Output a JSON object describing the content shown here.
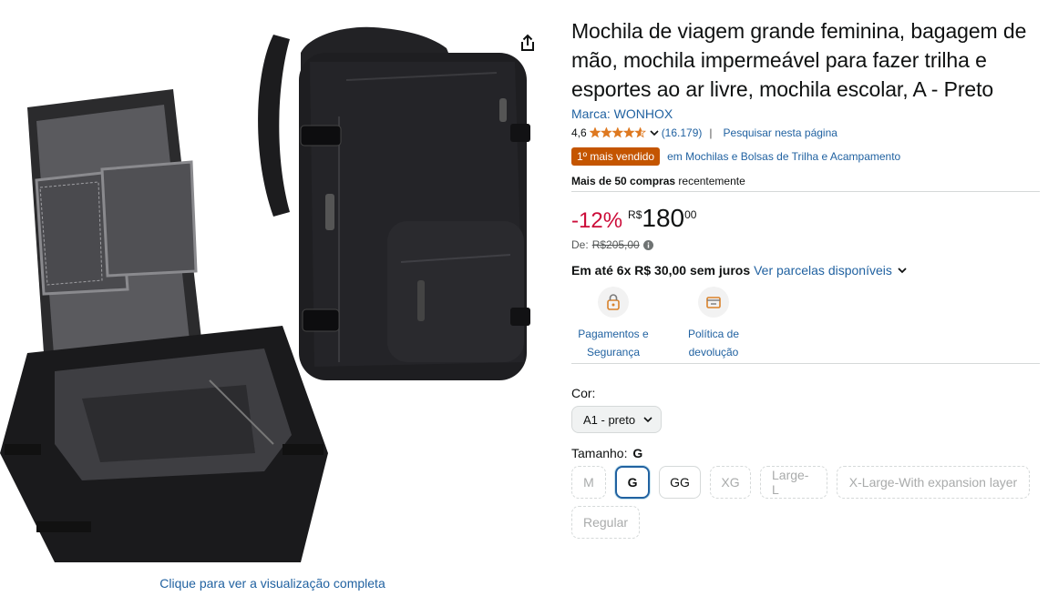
{
  "image": {
    "view_full_label": "Clique para ver a visualização completa",
    "share_icon": "share-icon"
  },
  "product": {
    "title": "Mochila de viagem grande feminina, bagagem de mão, mochila impermeável para fazer trilha e esportes ao ar livre, mochila escolar, A - Preto",
    "brand": "Marca: WONHOX",
    "rating": {
      "value": "4,6",
      "stars_fraction": 0.92,
      "count": "(16.179)",
      "separator": "|",
      "search_link": "Pesquisar nesta página"
    },
    "bestseller": {
      "badge": "1º mais vendido",
      "category": "em Mochilas e Bolsas de Trilha e Acampamento"
    },
    "bought": {
      "strong": "Mais de 50 compras",
      "rest": " recentemente"
    }
  },
  "price": {
    "discount": "-12%",
    "currency": "R$",
    "whole": "180",
    "cents": "00",
    "list_label": "De:",
    "list_price": "R$205,00",
    "installment_bold": "Em até 6x R$ 30,00 sem juros",
    "installment_link": "Ver parcelas disponíveis"
  },
  "features": [
    {
      "icon": "lock-shield-icon",
      "label_line1": "Pagamentos e",
      "label_line2": "Segurança"
    },
    {
      "icon": "return-box-icon",
      "label_line1": "Política de",
      "label_line2": "devolução"
    }
  ],
  "variants": {
    "color_label": "Cor:",
    "color_selected": "A1 - preto",
    "size_label": "Tamanho:",
    "size_selected": "G",
    "sizes": [
      "M",
      "G",
      "GG",
      "XG",
      "Large-L",
      "X-Large-With expansion layer",
      "Regular"
    ]
  },
  "colors": {
    "link": "#2162a1",
    "discount": "#cc0c39",
    "badge": "#c45500",
    "star": "#de7921"
  }
}
